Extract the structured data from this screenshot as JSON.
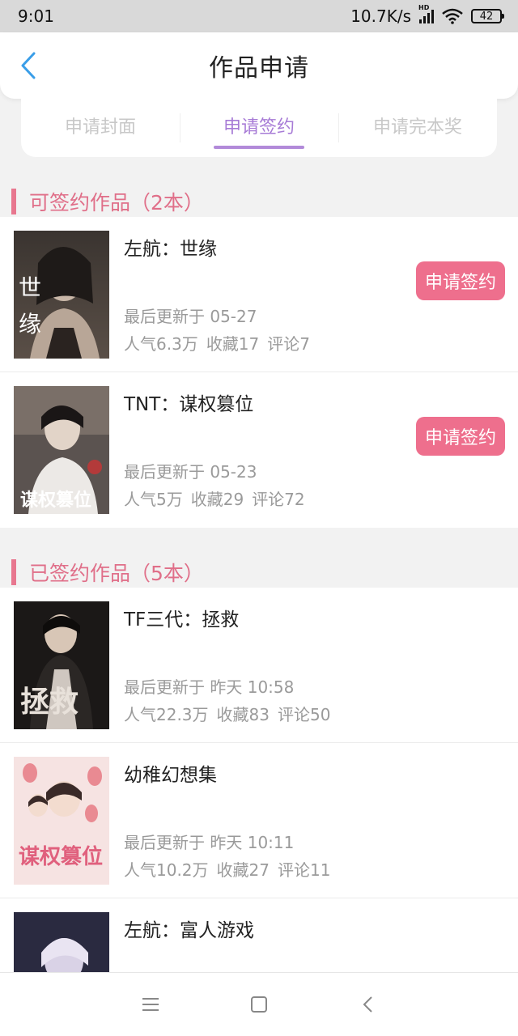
{
  "status_bar": {
    "time": "9:01",
    "network_speed": "10.7K/s",
    "signal_tag": "HD",
    "battery": "42"
  },
  "header": {
    "title": "作品申请"
  },
  "tabs": [
    {
      "label": "申请封面",
      "active": false
    },
    {
      "label": "申请签约",
      "active": true
    },
    {
      "label": "申请完本奖",
      "active": false
    }
  ],
  "sections": [
    {
      "title": "可签约作品（2本）",
      "books": [
        {
          "title": "左航：世缘",
          "update": "最后更新于 05-27",
          "popularity": "人气6.3万",
          "favorites": "收藏17",
          "comments": "评论7",
          "action": "申请签约",
          "cover_text": "世\n缘"
        },
        {
          "title": "TNT：谋权篡位",
          "update": "最后更新于 05-23",
          "popularity": "人气5万",
          "favorites": "收藏29",
          "comments": "评论72",
          "action": "申请签约",
          "cover_text": "谋权篡位"
        }
      ]
    },
    {
      "title": "已签约作品（5本）",
      "books": [
        {
          "title": "TF三代：拯救",
          "update": "最后更新于 昨天 10:58",
          "popularity": "人气22.3万",
          "favorites": "收藏83",
          "comments": "评论50",
          "cover_text": "拯救"
        },
        {
          "title": "幼稚幻想集",
          "update": "最后更新于 昨天 10:11",
          "popularity": "人气10.2万",
          "favorites": "收藏27",
          "comments": "评论11",
          "cover_text": "谋权篡位"
        },
        {
          "title": "左航：富人游戏",
          "update": "",
          "popularity": "",
          "favorites": "",
          "comments": "",
          "cover_text": ""
        }
      ]
    }
  ],
  "colors": {
    "accent_pink": "#ee6f8d",
    "tab_active": "#a77bd6",
    "section_title": "#e06f89"
  }
}
